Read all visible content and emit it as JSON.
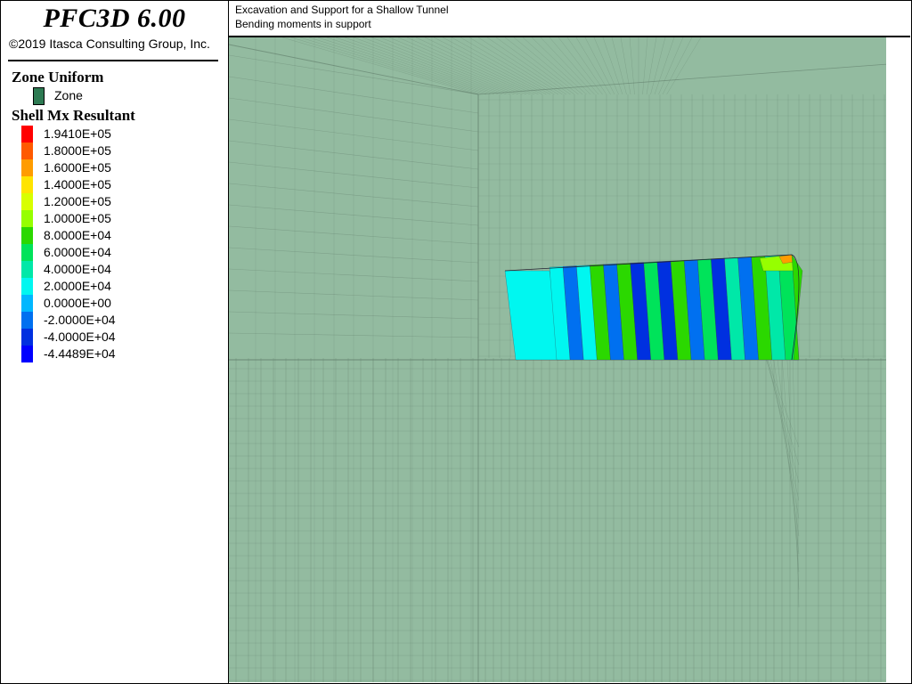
{
  "app": {
    "title": "PFC3D 6.00",
    "copyright": "©2019 Itasca Consulting Group, Inc."
  },
  "plot": {
    "title_line1": "Excavation and Support for a Shallow Tunnel",
    "title_line2": "Bending moments in support"
  },
  "zone_legend": {
    "title": "Zone Uniform",
    "item_label": "Zone",
    "item_color": "#2d7a52"
  },
  "shell_legend": {
    "title": "Shell Mx Resultant",
    "entries": [
      {
        "label": "1.9410E+05",
        "color": "#ff0000"
      },
      {
        "label": "1.8000E+05",
        "color": "#ff5a00"
      },
      {
        "label": "1.6000E+05",
        "color": "#ff9c00"
      },
      {
        "label": "1.4000E+05",
        "color": "#ffe400"
      },
      {
        "label": "1.2000E+05",
        "color": "#d8ff00"
      },
      {
        "label": "1.0000E+05",
        "color": "#96ff00"
      },
      {
        "label": "8.0000E+04",
        "color": "#2bd800"
      },
      {
        "label": "6.0000E+04",
        "color": "#00e35a"
      },
      {
        "label": "4.0000E+04",
        "color": "#00e8a8"
      },
      {
        "label": "2.0000E+04",
        "color": "#00f7f0"
      },
      {
        "label": "0.0000E+00",
        "color": "#00b7ff"
      },
      {
        "label": "-2.0000E+04",
        "color": "#0070f0"
      },
      {
        "label": "-4.0000E+04",
        "color": "#0030e0"
      },
      {
        "label": "-4.4489E+04",
        "color": "#0000ff"
      }
    ]
  },
  "colors": {
    "zone_fill": "#93bba0",
    "mesh_line": "#5e7a68"
  }
}
